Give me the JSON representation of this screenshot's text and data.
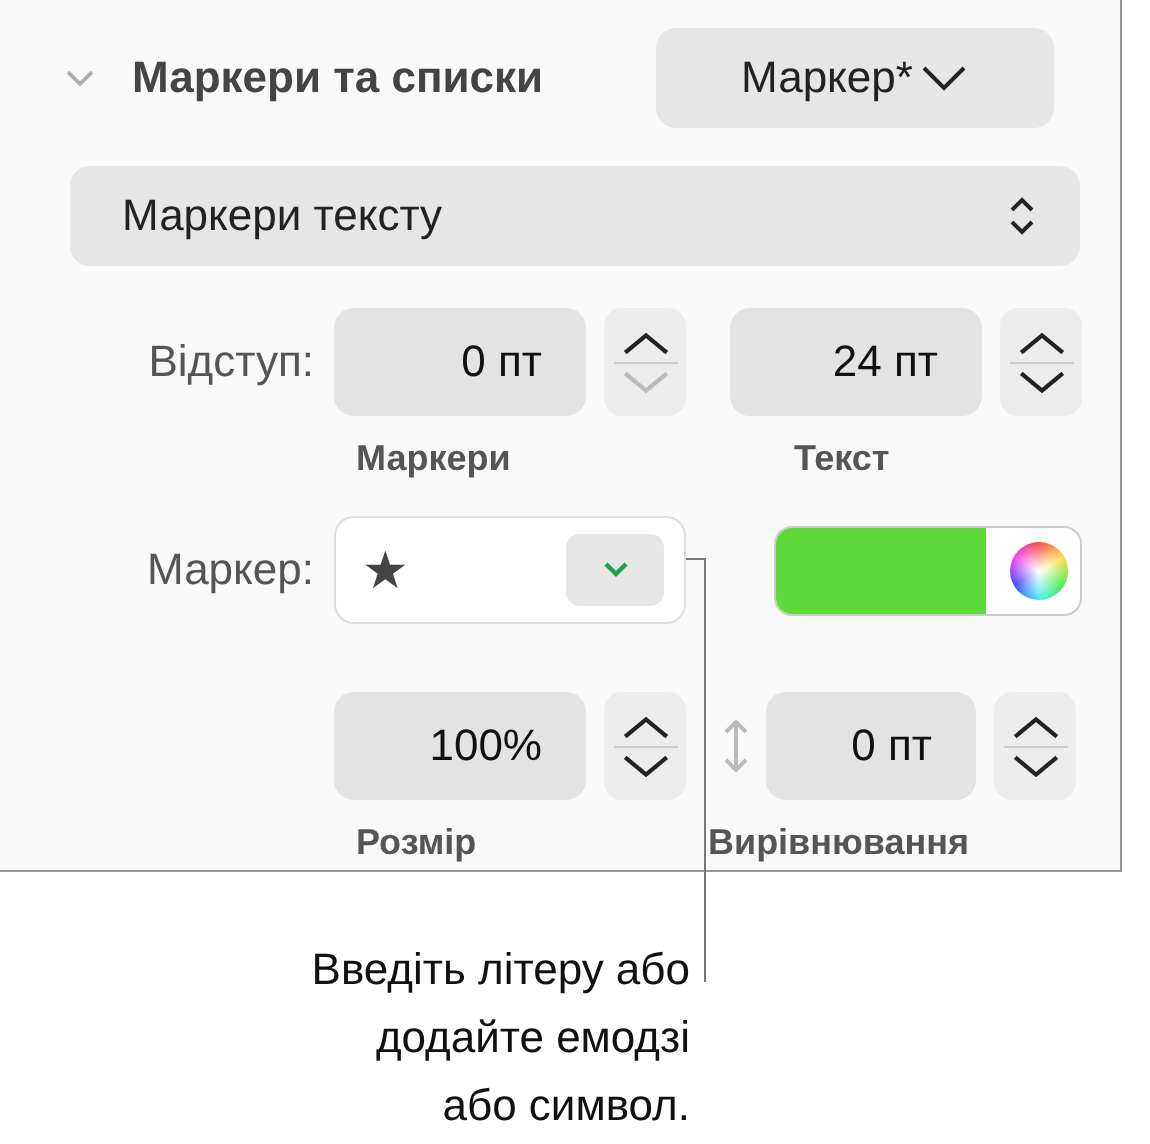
{
  "section": {
    "title": "Маркери та списки",
    "expanded": true,
    "style_popup": "Маркер*"
  },
  "type_popup": "Маркери тексту",
  "indent": {
    "label": "Відступ:",
    "fields": [
      {
        "value": "0 пт",
        "caption": "Маркери",
        "up_disabled": false,
        "down_disabled": true
      },
      {
        "value": "24 пт",
        "caption": "Текст",
        "up_disabled": false,
        "down_disabled": false
      }
    ]
  },
  "marker": {
    "label": "Маркер:",
    "symbol": "★",
    "color": "#5fd93a"
  },
  "size": {
    "value": "100%",
    "caption": "Розмір",
    "up_disabled": false,
    "down_disabled": false
  },
  "alignment": {
    "value": "0 пт",
    "caption": "Вирівнювання",
    "up_disabled": false,
    "down_disabled": false
  },
  "callout": "Введіть літеру або\nдодайте емодзі\nабо символ."
}
